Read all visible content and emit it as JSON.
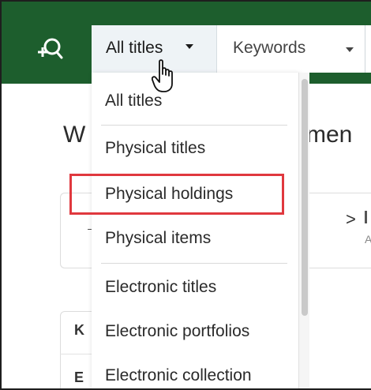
{
  "header": {
    "scope_dropdown": {
      "selected": "All titles"
    },
    "field_dropdown": {
      "selected": "Keywords"
    },
    "accent_color": "#1d5e2d"
  },
  "menu": {
    "items": [
      {
        "label": "All titles",
        "divider_after": true
      },
      {
        "label": "Physical titles"
      },
      {
        "label": "Physical holdings",
        "highlighted": true
      },
      {
        "label": "Physical items",
        "divider_after": true
      },
      {
        "label": "Electronic titles"
      },
      {
        "label": "Electronic portfolios"
      },
      {
        "label": "Electronic collection"
      }
    ],
    "highlight_color": "#e0383e"
  },
  "page": {
    "title_left": "W",
    "title_right": "men",
    "card_left_text": "→",
    "card_right_chevron": ">",
    "card_right_subtext": "A",
    "lower_row1": "K",
    "lower_row2": "E"
  },
  "icons": {
    "search": "advanced-search-icon",
    "cursor": "hand-pointer-icon"
  }
}
